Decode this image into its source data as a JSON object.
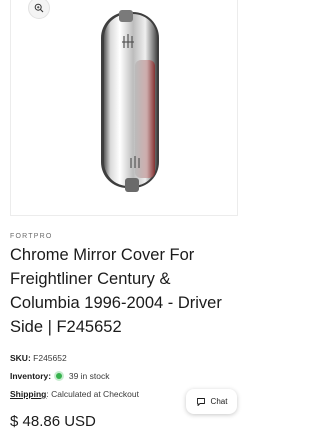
{
  "product": {
    "vendor": "FORTPRO",
    "title": "Chrome Mirror Cover For Freightliner Century & Columbia 1996-2004 - Driver Side | F245652",
    "sku_label": "SKU:",
    "sku_value": "F245652",
    "inventory_label": "Inventory:",
    "inventory_value": "39 in stock",
    "shipping_label": "Shipping",
    "shipping_value": ": Calculated at Checkout",
    "price": "$ 48.86 USD",
    "image_icon": "zoom-icon"
  },
  "chat": {
    "label": "Chat",
    "icon": "chat-bubble-icon"
  },
  "colors": {
    "in_stock": "#37b24d",
    "text": "#1b1b1b"
  }
}
